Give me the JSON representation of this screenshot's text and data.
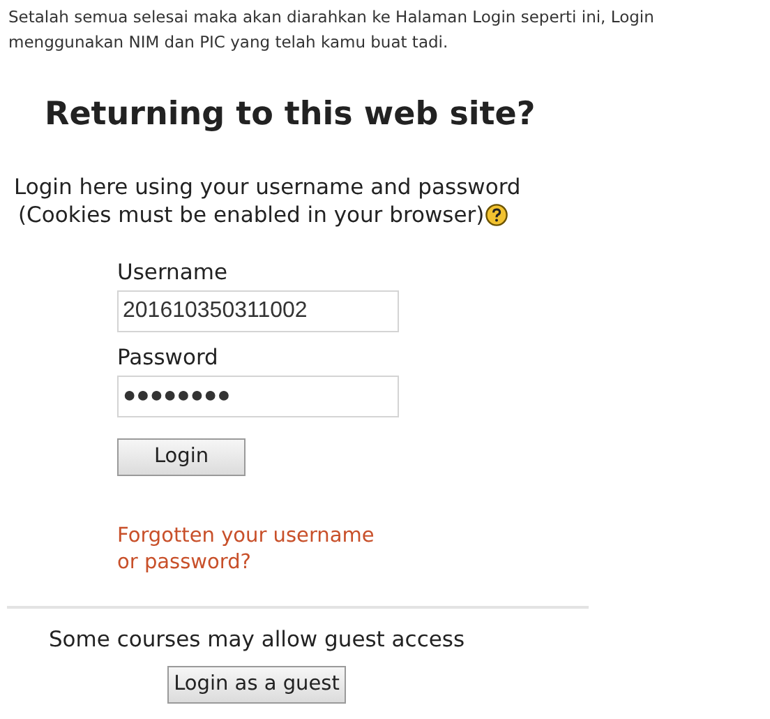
{
  "intro": "Setalah semua selesai maka akan diarahkan ke Halaman Login seperti ini, Login menggunakan NIM dan PIC yang telah kamu buat tadi.",
  "heading": "Returning to this web site?",
  "instructions": [
    "Login here using your username and password",
    "(Cookies must be enabled in your browser)"
  ],
  "fields": [
    {
      "label": "Username",
      "value": "201610350311002"
    },
    {
      "label": "Password",
      "value": "●●●●●●●●"
    }
  ],
  "login_button": "Login",
  "forgot_link": [
    "Forgotten your username",
    "or password?"
  ],
  "guest_text": "Some courses may allow guest access",
  "guest_button": "Login as a guest"
}
